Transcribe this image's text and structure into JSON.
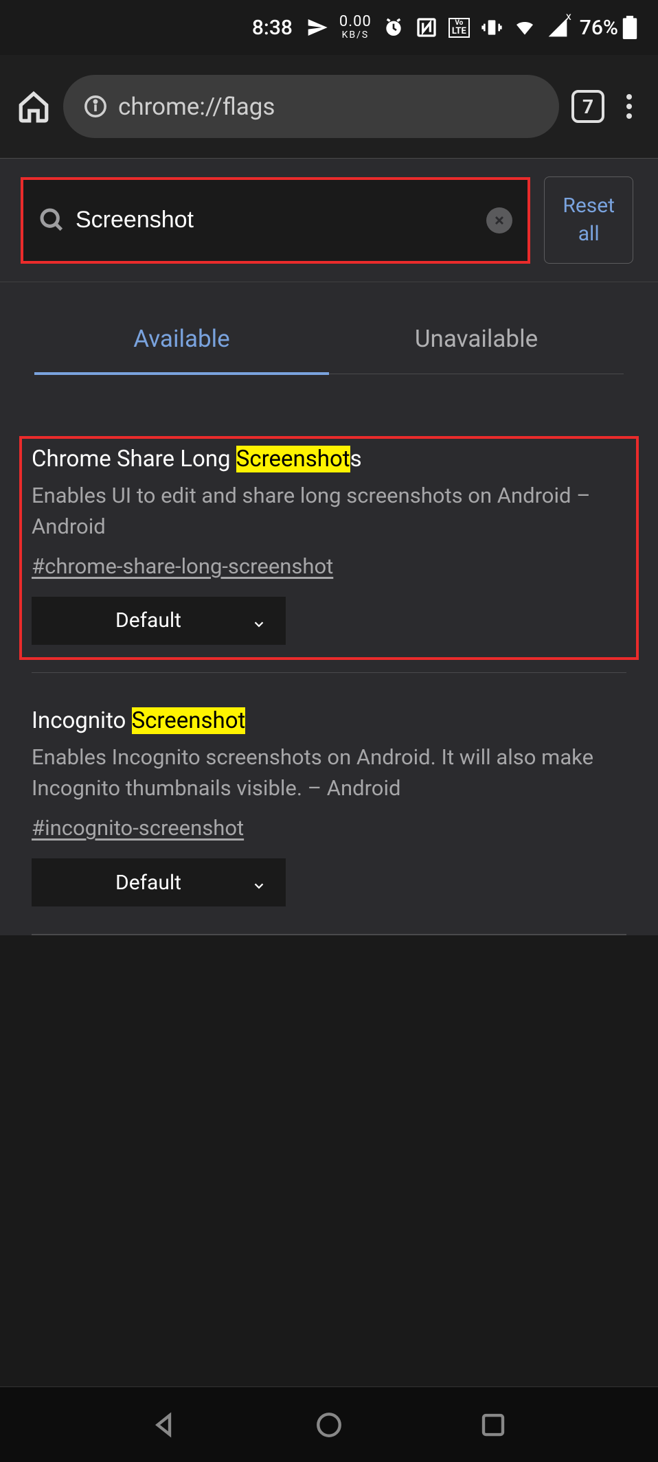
{
  "status": {
    "time": "8:38",
    "kbs_top": "0.00",
    "kbs_bot": "KB/S",
    "battery": "76%",
    "signal_x": "x"
  },
  "browser": {
    "url": "chrome://flags",
    "tab_count": "7"
  },
  "search": {
    "value": "Screenshot",
    "reset_line1": "Reset",
    "reset_line2": "all"
  },
  "tabs": {
    "available": "Available",
    "unavailable": "Unavailable"
  },
  "flags": [
    {
      "title_pre": "Chrome Share Long ",
      "title_hl": "Screenshot",
      "title_post": "s",
      "desc": "Enables UI to edit and share long screenshots on Android – Android",
      "hash": "#chrome-share-long-screenshot",
      "value": "Default"
    },
    {
      "title_pre": "Incognito ",
      "title_hl": "Screenshot",
      "title_post": "",
      "desc": "Enables Incognito screenshots on Android. It will also make Incognito thumbnails visible. – Android",
      "hash": "#incognito-screenshot",
      "value": "Default"
    }
  ]
}
